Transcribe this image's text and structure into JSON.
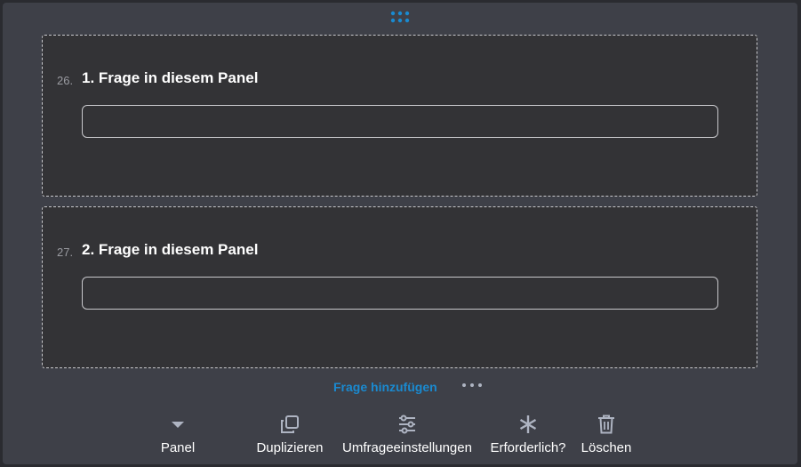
{
  "questions": [
    {
      "number": "26.",
      "title": "1. Frage in diesem Panel",
      "value": ""
    },
    {
      "number": "27.",
      "title": "2. Frage in diesem Panel",
      "value": ""
    }
  ],
  "actions": {
    "add_question": "Frage hinzufügen"
  },
  "toolbar": {
    "panel": "Panel",
    "duplicate": "Duplizieren",
    "settings": "Umfrageeinstellungen",
    "required": "Erforderlich?",
    "delete": "Löschen"
  },
  "icons": {
    "drag": "drag-handle-icon",
    "more": "more-dots-icon",
    "panel": "chevron-down-icon",
    "duplicate": "duplicate-icon",
    "settings": "settings-sliders-icon",
    "required": "asterisk-icon",
    "delete": "trash-icon"
  },
  "colors": {
    "background": "#3e4048",
    "card": "#333336",
    "accent": "#1a8ad0",
    "icon": "#aeb4c2",
    "text": "#ffffff"
  }
}
